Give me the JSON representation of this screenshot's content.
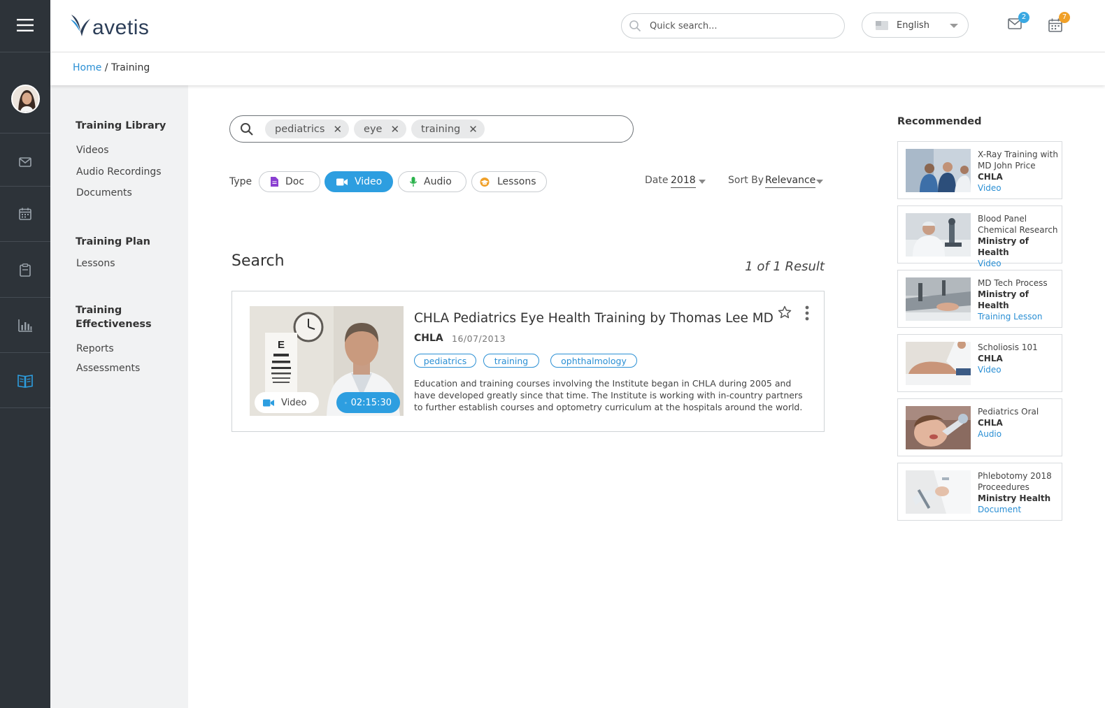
{
  "app": {
    "logo_text": "avetis"
  },
  "header": {
    "search_placeholder": "Quick search...",
    "language": "English",
    "mail_badge": "2",
    "calendar_badge": "7",
    "colors": {
      "mail_badge": "#3aa8e2",
      "calendar_badge": "#f0a028"
    }
  },
  "breadcrumb": {
    "home": "Home",
    "separator": "/",
    "current": "Training"
  },
  "subnav": {
    "library_title": "Training Library",
    "library_links": [
      "Videos",
      "Audio Recordings",
      "Documents"
    ],
    "plan_title": "Training Plan",
    "plan_links": [
      "Lessons"
    ],
    "effectiveness_title_1": "Training",
    "effectiveness_title_2": "Effectiveness",
    "effectiveness_links": [
      "Reports",
      "Assessments"
    ]
  },
  "search": {
    "chips": [
      "pediatrics",
      "eye",
      "training"
    ],
    "type_label": "Type",
    "types": [
      "Doc",
      "Video",
      "Audio",
      "Lessons"
    ],
    "active_type": "Video",
    "date_label": "Date",
    "date_value": "2018",
    "sort_label": "Sort By",
    "sort_value": "Relevance"
  },
  "results": {
    "heading": "Search",
    "count": "1 of 1 Result",
    "items": [
      {
        "title": "CHLA Pediatrics Eye Health Training by Thomas Lee MD",
        "org": "CHLA",
        "date": "16/07/2013",
        "tags": [
          "pediatrics",
          "training",
          "ophthalmology"
        ],
        "description": "Education and training courses involving the Institute began in CHLA during 2005 and have developed greatly since that time. The Institute is working with in-country partners to further establish courses and optometry curriculum at the hospitals around the world.",
        "media_type": "Video",
        "duration": "02:15:30"
      }
    ]
  },
  "recommended": {
    "title": "Recommended",
    "items": [
      {
        "title": "X-Ray Training with MD John Price",
        "org": "CHLA",
        "type": "Video"
      },
      {
        "title": "Blood Panel Chemical Research",
        "org": "Ministry of Health",
        "type": "Video"
      },
      {
        "title": "MD Tech Process",
        "org": "Ministry of Health",
        "type": "Training Lesson"
      },
      {
        "title": "Scholiosis 101",
        "org": "CHLA",
        "type": "Video"
      },
      {
        "title": "Pediatrics Oral",
        "org": "CHLA",
        "type": "Audio"
      },
      {
        "title": "Phlebotomy 2018 Proceedures",
        "org": "Ministry Health",
        "type": "Document"
      }
    ]
  }
}
